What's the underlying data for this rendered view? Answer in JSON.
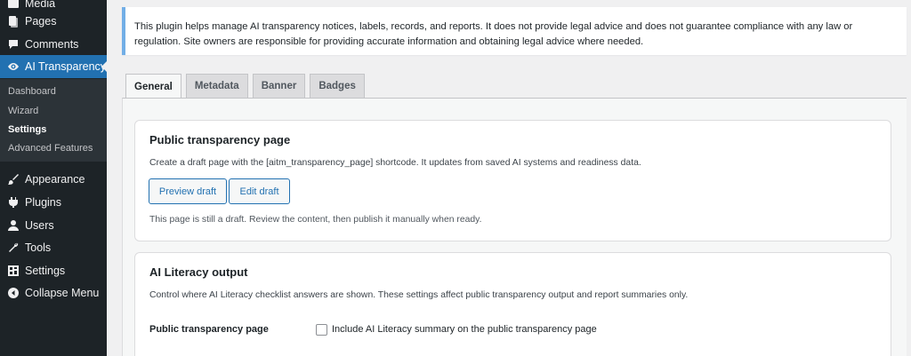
{
  "sidebar": {
    "items": [
      {
        "label": "Media",
        "icon": "media-icon"
      },
      {
        "label": "Pages",
        "icon": "pages-icon"
      },
      {
        "label": "Comments",
        "icon": "comments-icon"
      },
      {
        "label": "AI Transparency",
        "icon": "eye-icon",
        "active": true
      },
      {
        "label": "Appearance",
        "icon": "brush-icon"
      },
      {
        "label": "Plugins",
        "icon": "plugin-icon"
      },
      {
        "label": "Users",
        "icon": "user-icon"
      },
      {
        "label": "Tools",
        "icon": "wrench-icon"
      },
      {
        "label": "Settings",
        "icon": "settings-icon"
      },
      {
        "label": "Collapse Menu",
        "icon": "collapse-icon"
      }
    ],
    "submenu": [
      {
        "label": "Dashboard"
      },
      {
        "label": "Wizard"
      },
      {
        "label": "Settings",
        "current": true
      },
      {
        "label": "Advanced Features"
      }
    ]
  },
  "notice": {
    "text": "This plugin helps manage AI transparency notices, labels, records, and reports. It does not provide legal advice and does not guarantee compliance with any law or regulation. Site owners are responsible for providing accurate information and obtaining legal advice where needed."
  },
  "tabs": [
    {
      "label": "General",
      "active": true
    },
    {
      "label": "Metadata"
    },
    {
      "label": "Banner"
    },
    {
      "label": "Badges"
    }
  ],
  "transparency_card": {
    "title": "Public transparency page",
    "description": "Create a draft page with the [aitm_transparency_page] shortcode. It updates from saved AI systems and readiness data.",
    "preview_button": "Preview draft",
    "edit_button": "Edit draft",
    "note": "This page is still a draft. Review the content, then publish it manually when ready."
  },
  "literacy_card": {
    "title": "AI Literacy output",
    "description": "Control where AI Literacy checklist answers are shown. These settings affect public transparency output and report summaries only.",
    "row_label": "Public transparency page",
    "checkbox_label": "Include AI Literacy summary on the public transparency page",
    "checked": false
  },
  "colors": {
    "sidebar_bg": "#1d2327",
    "accent": "#2271b1",
    "notice_border": "#72aee6"
  }
}
